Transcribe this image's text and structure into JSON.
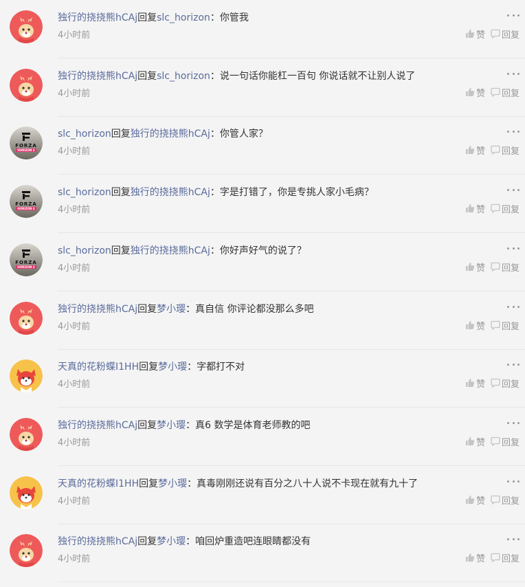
{
  "comments": [
    {
      "avatar": "deer-avatar",
      "author": "独行的挠挠熊hCAj",
      "reply_word": "回复",
      "target": "slc_horizon",
      "colon": "：",
      "content": "你管我",
      "time": "4小时前",
      "like_label": "赞",
      "reply_label": "回复"
    },
    {
      "avatar": "deer-avatar",
      "author": "独行的挠挠熊hCAj",
      "reply_word": "回复",
      "target": "slc_horizon",
      "colon": "：",
      "content": "说一句话你能杠一百句 你说话就不让别人说了",
      "time": "4小时前",
      "like_label": "赞",
      "reply_label": "回复"
    },
    {
      "avatar": "forza-avatar",
      "author": "slc_horizon",
      "reply_word": "回复",
      "target": "独行的挠挠熊hCAj",
      "colon": "：",
      "content": "你管人家？",
      "time": "4小时前",
      "like_label": "赞",
      "reply_label": "回复"
    },
    {
      "avatar": "forza-avatar",
      "author": "slc_horizon",
      "reply_word": "回复",
      "target": "独行的挠挠熊hCAj",
      "colon": "：",
      "content": "字是打错了，你是专挑人家小毛病？",
      "time": "4小时前",
      "like_label": "赞",
      "reply_label": "回复"
    },
    {
      "avatar": "forza-avatar",
      "author": "slc_horizon",
      "reply_word": "回复",
      "target": "独行的挠挠熊hCAj",
      "colon": "：",
      "content": "你好声好气的说了？",
      "time": "4小时前",
      "like_label": "赞",
      "reply_label": "回复"
    },
    {
      "avatar": "deer-avatar",
      "author": "独行的挠挠熊hCAj",
      "reply_word": "回复",
      "target": "梦小璎",
      "colon": "：",
      "content": "真自信 你评论都没那么多吧",
      "time": "4小时前",
      "like_label": "赞",
      "reply_label": "回复"
    },
    {
      "avatar": "fox-avatar",
      "author": "天真的花粉蝶I1HH",
      "reply_word": "回复",
      "target": "梦小璎",
      "colon": "：",
      "content": "字都打不对",
      "time": "4小时前",
      "like_label": "赞",
      "reply_label": "回复"
    },
    {
      "avatar": "deer-avatar",
      "author": "独行的挠挠熊hCAj",
      "reply_word": "回复",
      "target": "梦小璎",
      "colon": "：",
      "content": "真6 数学是体育老师教的吧",
      "time": "4小时前",
      "like_label": "赞",
      "reply_label": "回复"
    },
    {
      "avatar": "fox-avatar",
      "author": "天真的花粉蝶I1HH",
      "reply_word": "回复",
      "target": "梦小璎",
      "colon": "：",
      "content": "真毒刚刚还说有百分之八十人说不卡现在就有九十了",
      "time": "4小时前",
      "like_label": "赞",
      "reply_label": "回复"
    },
    {
      "avatar": "deer-avatar",
      "author": "独行的挠挠熊hCAj",
      "reply_word": "回复",
      "target": "梦小璎",
      "colon": "：",
      "content": "咱回炉重造吧连眼睛都没有",
      "time": "4小时前",
      "like_label": "赞",
      "reply_label": "回复"
    }
  ],
  "forza_logo": {
    "brand": "FORZA",
    "sub": "HORIZON 4"
  },
  "colors": {
    "page_bg": "#f4f4f4",
    "username": "#5a6b9c",
    "text": "#333333",
    "muted": "#999999",
    "divider": "#e6e6e6"
  }
}
